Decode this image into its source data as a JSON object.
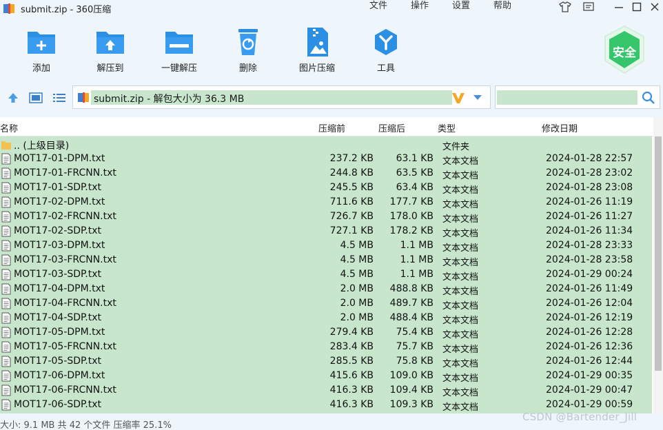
{
  "window": {
    "title": "submit.zip - 360压缩",
    "menus": [
      "文件",
      "操作",
      "设置",
      "帮助"
    ]
  },
  "toolbar": {
    "buttons": [
      {
        "label": "添加",
        "icon": "add-folder-icon"
      },
      {
        "label": "解压到",
        "icon": "extract-to-icon"
      },
      {
        "label": "一键解压",
        "icon": "one-click-extract-icon"
      },
      {
        "label": "删除",
        "icon": "recycle-bin-icon"
      },
      {
        "label": "图片压缩",
        "icon": "image-compress-icon"
      },
      {
        "label": "工具",
        "icon": "tools-icon"
      }
    ],
    "safe_badge": "安全"
  },
  "address": {
    "path_text": "submit.zip - 解包大小为 36.3 MB"
  },
  "columns": {
    "name": "名称",
    "size": "压缩前",
    "compressed": "压缩后",
    "type": "类型",
    "date": "修改日期"
  },
  "parent_row": {
    "name": ".. (上级目录)",
    "type": "文件夹"
  },
  "files": [
    {
      "name": "MOT17-01-DPM.txt",
      "size": "237.2 KB",
      "compressed": "63.1 KB",
      "type": "文本文档",
      "date": "2024-01-28 22:57"
    },
    {
      "name": "MOT17-01-FRCNN.txt",
      "size": "244.8 KB",
      "compressed": "63.5 KB",
      "type": "文本文档",
      "date": "2024-01-28 23:02"
    },
    {
      "name": "MOT17-01-SDP.txt",
      "size": "245.5 KB",
      "compressed": "63.4 KB",
      "type": "文本文档",
      "date": "2024-01-28 23:08"
    },
    {
      "name": "MOT17-02-DPM.txt",
      "size": "711.6 KB",
      "compressed": "177.7 KB",
      "type": "文本文档",
      "date": "2024-01-26 11:19"
    },
    {
      "name": "MOT17-02-FRCNN.txt",
      "size": "726.7 KB",
      "compressed": "178.0 KB",
      "type": "文本文档",
      "date": "2024-01-26 11:27"
    },
    {
      "name": "MOT17-02-SDP.txt",
      "size": "727.1 KB",
      "compressed": "178.2 KB",
      "type": "文本文档",
      "date": "2024-01-26 11:34"
    },
    {
      "name": "MOT17-03-DPM.txt",
      "size": "4.5 MB",
      "compressed": "1.1 MB",
      "type": "文本文档",
      "date": "2024-01-28 23:33"
    },
    {
      "name": "MOT17-03-FRCNN.txt",
      "size": "4.5 MB",
      "compressed": "1.1 MB",
      "type": "文本文档",
      "date": "2024-01-28 23:58"
    },
    {
      "name": "MOT17-03-SDP.txt",
      "size": "4.5 MB",
      "compressed": "1.1 MB",
      "type": "文本文档",
      "date": "2024-01-29 00:24"
    },
    {
      "name": "MOT17-04-DPM.txt",
      "size": "2.0 MB",
      "compressed": "488.8 KB",
      "type": "文本文档",
      "date": "2024-01-26 11:49"
    },
    {
      "name": "MOT17-04-FRCNN.txt",
      "size": "2.0 MB",
      "compressed": "489.7 KB",
      "type": "文本文档",
      "date": "2024-01-26 12:04"
    },
    {
      "name": "MOT17-04-SDP.txt",
      "size": "2.0 MB",
      "compressed": "488.4 KB",
      "type": "文本文档",
      "date": "2024-01-26 12:19"
    },
    {
      "name": "MOT17-05-DPM.txt",
      "size": "279.4 KB",
      "compressed": "75.4 KB",
      "type": "文本文档",
      "date": "2024-01-26 12:28"
    },
    {
      "name": "MOT17-05-FRCNN.txt",
      "size": "283.4 KB",
      "compressed": "75.7 KB",
      "type": "文本文档",
      "date": "2024-01-26 12:36"
    },
    {
      "name": "MOT17-05-SDP.txt",
      "size": "285.5 KB",
      "compressed": "75.8 KB",
      "type": "文本文档",
      "date": "2024-01-26 12:44"
    },
    {
      "name": "MOT17-06-DPM.txt",
      "size": "415.6 KB",
      "compressed": "109.0 KB",
      "type": "文本文档",
      "date": "2024-01-29 00:35"
    },
    {
      "name": "MOT17-06-FRCNN.txt",
      "size": "416.3 KB",
      "compressed": "109.4 KB",
      "type": "文本文档",
      "date": "2024-01-29 00:47"
    },
    {
      "name": "MOT17-06-SDP.txt",
      "size": "416.3 KB",
      "compressed": "109.3 KB",
      "type": "文本文档",
      "date": "2024-01-29 00:59"
    }
  ],
  "status": {
    "text": "大小: 9.1 MB 共 42 个文件 压缩率 25.1%"
  },
  "watermark": "CSDN @Bartender_Jill",
  "colors": {
    "accent": "#2b8fe3",
    "selection": "#c7e6cc",
    "safe_green": "#35c66b"
  }
}
